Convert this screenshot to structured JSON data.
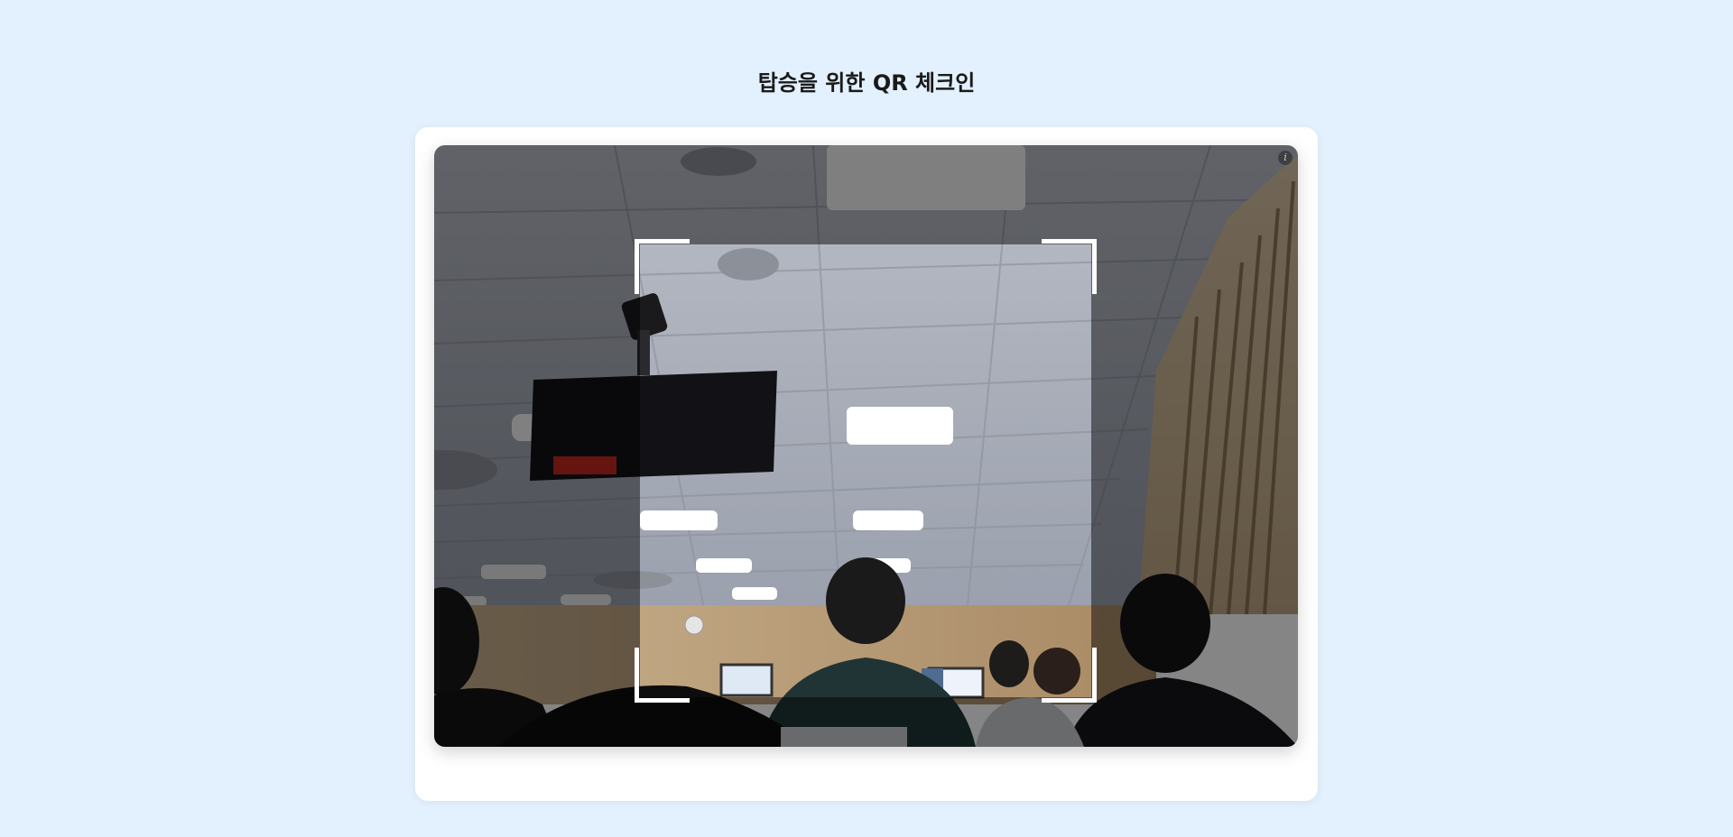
{
  "page": {
    "title": "탑승을 위한 QR 체크인"
  },
  "scanner": {
    "info_icon_glyph": "i",
    "icon_name": "info-icon"
  },
  "colors": {
    "background": "#e3f0fd",
    "card": "#ffffff",
    "frame": "#ffffff"
  }
}
